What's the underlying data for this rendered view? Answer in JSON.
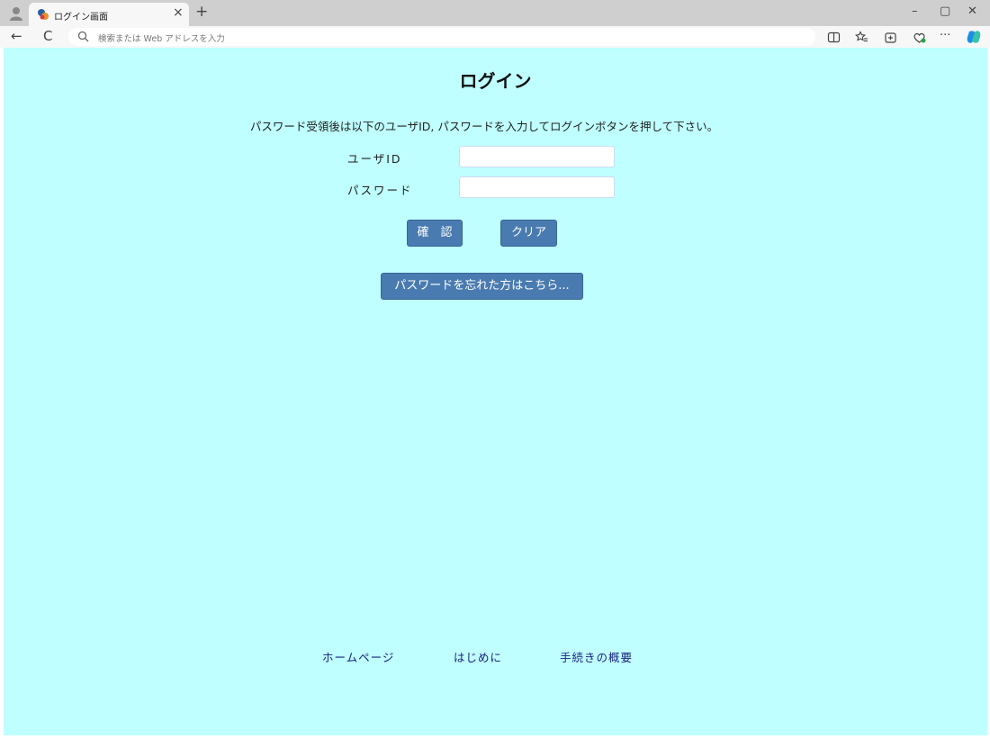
{
  "browser": {
    "tab_title": "ログイン画面",
    "tab_close": "×",
    "new_tab": "+",
    "address_placeholder": "検索または Web アドレスを入力",
    "back": "←",
    "refresh": "C",
    "window_controls": {
      "minimize": "–",
      "restore": "▢",
      "close": "✕"
    },
    "more_menu": "···"
  },
  "login": {
    "title": "ログイン",
    "instruction": "パスワード受領後は以下のユーザID, パスワードを入力してログインボタンを押して下さい。",
    "user_id_label": "ユーザID",
    "password_label": "パスワード",
    "confirm_button": "確　認",
    "clear_button": "クリア",
    "forgot_button": "パスワードを忘れた方はこちら..."
  },
  "footer": {
    "links": [
      "ホームページ",
      "はじめに",
      "手続きの概要"
    ]
  },
  "colors": {
    "page_background": "#bfffff",
    "button": "#4a7bb0",
    "link": "#1a237e"
  }
}
